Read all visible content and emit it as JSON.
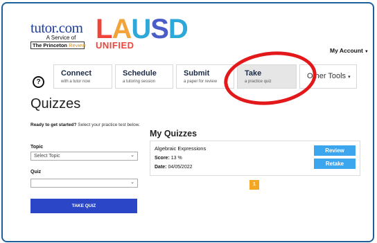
{
  "logos": {
    "tutor_word": "tutor.com",
    "tutor_service": "A Service of",
    "princeton_bold": "The Princeton",
    "princeton_review": "Review",
    "lausd": [
      "L",
      "A",
      "U",
      "S",
      "D"
    ],
    "unified": "UNIFIED"
  },
  "header": {
    "account_label": "My Account"
  },
  "nav": {
    "help_label": "?",
    "items": [
      {
        "title": "Connect",
        "sub": "with a tutor now"
      },
      {
        "title": "Schedule",
        "sub": "a tutoring session"
      },
      {
        "title": "Submit",
        "sub": "a paper for review"
      },
      {
        "title": "Take",
        "sub": "a practice quiz"
      },
      {
        "title": "Other Tools",
        "caret": "▾"
      }
    ]
  },
  "left": {
    "page_title": "Quizzes",
    "intro_bold": "Ready to get started?",
    "intro_rest": " Select your practice test below.",
    "topic_label": "Topic",
    "topic_value": "Select Topic",
    "quiz_label": "Quiz",
    "quiz_value": "",
    "take_button": "TAKE QUIZ"
  },
  "right": {
    "heading": "My Quizzes",
    "quizzes": [
      {
        "name": "Algebraic Expressions",
        "score_label": "Score:",
        "score_value": "13 %",
        "date_label": "Date:",
        "date_value": "04/05/2022",
        "review_label": "Review",
        "retake_label": "Retake"
      }
    ],
    "page_number": "1"
  },
  "colors": {
    "frame_border": "#1f5f99",
    "highlight_ellipse": "#e3181a",
    "take_button_bg": "#2b47c8",
    "action_button_bg": "#3ba6ee",
    "pager_bg": "#f5a623"
  }
}
